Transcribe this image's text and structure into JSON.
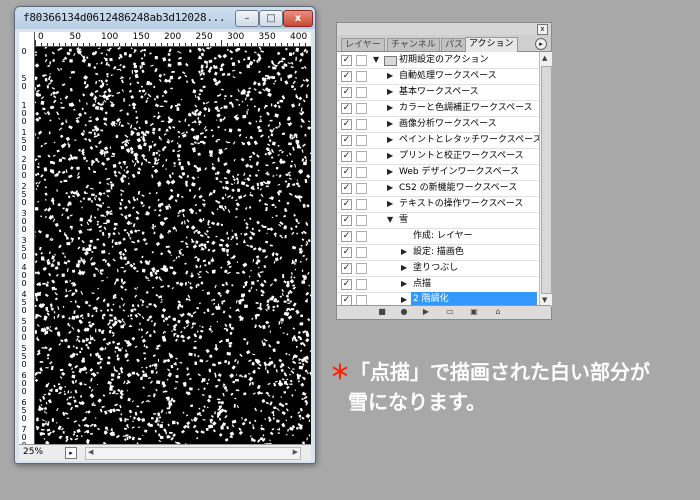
{
  "document": {
    "title": "f80366134d0612486248ab3d12028...",
    "window_buttons": {
      "minimize": "–",
      "maximize": "□",
      "close": "x"
    },
    "ruler": {
      "h_labels": [
        "0",
        "50",
        "100",
        "150",
        "200",
        "250",
        "300",
        "350",
        "400"
      ],
      "v_labels": [
        "0",
        "50",
        "100",
        "150",
        "200",
        "250",
        "300",
        "350",
        "400",
        "450",
        "500",
        "550",
        "600",
        "650",
        "700"
      ]
    },
    "status": {
      "zoom": "25%"
    }
  },
  "panel": {
    "close_glyph": "x",
    "tabs": [
      {
        "label": "レイヤー"
      },
      {
        "label": "チャンネル"
      },
      {
        "label": "パス"
      },
      {
        "label": "アクション",
        "active": true
      }
    ],
    "menu_glyph": "▸",
    "actions": [
      {
        "label": "初期設定のアクション",
        "level": 0,
        "checked": true,
        "expanded": true,
        "folder": true
      },
      {
        "label": "自動処理ワークスペース",
        "level": 1,
        "checked": true
      },
      {
        "label": "基本ワークスペース",
        "level": 1,
        "checked": true
      },
      {
        "label": "カラーと色調補正ワークスペース",
        "level": 1,
        "checked": true
      },
      {
        "label": "画像分析ワークスペース",
        "level": 1,
        "checked": true
      },
      {
        "label": "ペイントとレタッチワークスペース",
        "level": 1,
        "checked": true
      },
      {
        "label": "プリントと校正ワークスペース",
        "level": 1,
        "checked": true
      },
      {
        "label": "Web デザインワークスペース",
        "level": 1,
        "checked": true
      },
      {
        "label": "CS2 の新機能ワークスペース",
        "level": 1,
        "checked": true
      },
      {
        "label": "テキストの操作ワークスペース",
        "level": 1,
        "checked": true
      },
      {
        "label": "雪",
        "level": 1,
        "checked": true,
        "expanded": true
      },
      {
        "label": "作成: レイヤー",
        "level": 2,
        "checked": true,
        "no_arrow": true
      },
      {
        "label": "設定: 描画色",
        "level": 2,
        "checked": true
      },
      {
        "label": "塗りつぶし",
        "level": 2,
        "checked": true
      },
      {
        "label": "点描",
        "level": 2,
        "checked": true
      },
      {
        "label": "2 階調化",
        "level": 2,
        "checked": true,
        "selected": true
      }
    ],
    "bottom_buttons": [
      "stop-icon",
      "record-icon",
      "play-icon",
      "new-set-icon",
      "new-action-icon",
      "trash-icon"
    ]
  },
  "annotation": {
    "star": "＊",
    "line1": "「点描」で描画された白い部分が",
    "line2": "雪になります。"
  },
  "colors": {
    "background": "#a8a8a8",
    "selection": "#3399ff",
    "annotation_star": "#ff2200",
    "canvas": "#000000"
  }
}
